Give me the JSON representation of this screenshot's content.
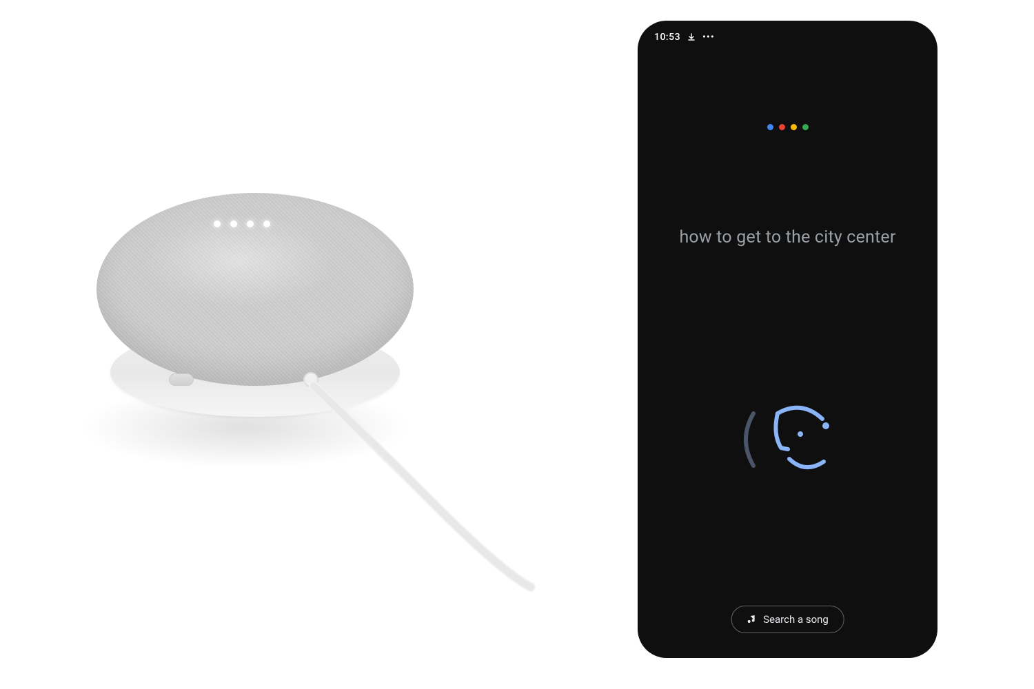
{
  "device": {
    "name": "smart-speaker",
    "light_count": 4
  },
  "phone": {
    "status_bar": {
      "time": "10:53",
      "download_icon": "download-icon",
      "more_icon": "more-icon"
    },
    "assistant": {
      "dots": [
        {
          "color": "#4285f4"
        },
        {
          "color": "#ea4335"
        },
        {
          "color": "#fbbc04"
        },
        {
          "color": "#34a853"
        }
      ],
      "query": "how to get to the city center",
      "listening_icon": "listening-face-icon"
    },
    "search_song": {
      "label": "Search a song",
      "icon": "music-note-icon"
    }
  }
}
